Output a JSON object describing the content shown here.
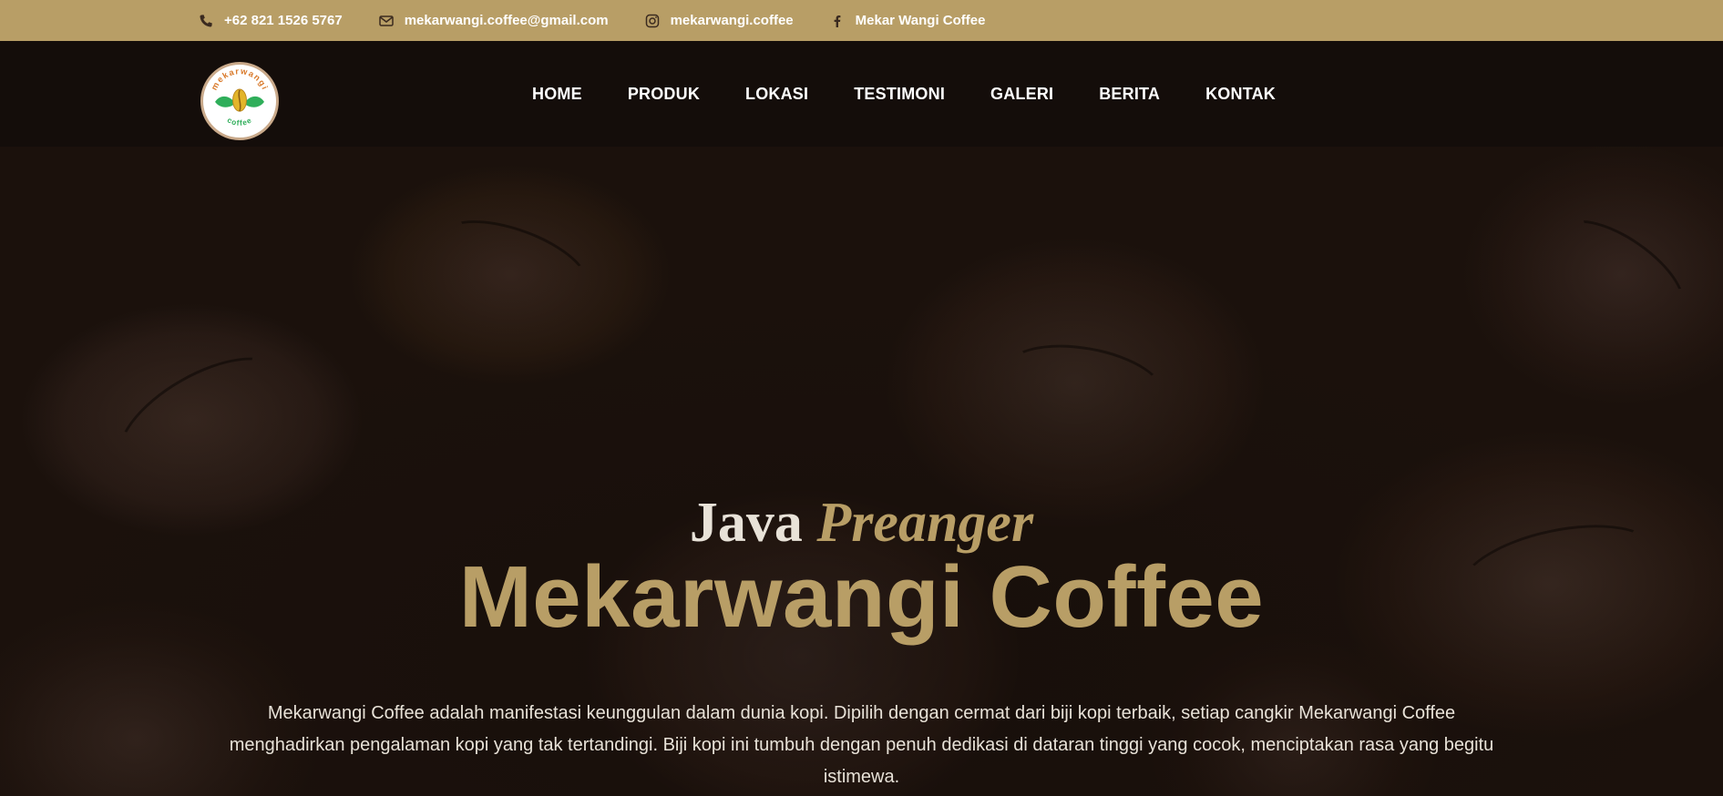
{
  "topbar": {
    "phone": "+62 821 1526 5767",
    "email": "mekarwangi.coffee@gmail.com",
    "instagram": "mekarwangi.coffee",
    "facebook": "Mekar Wangi Coffee"
  },
  "logo": {
    "top_text": "mekarwangi",
    "bottom_text": "coffee"
  },
  "nav": {
    "items": [
      "HOME",
      "PRODUK",
      "LOKASI",
      "TESTIMONI",
      "GALERI",
      "BERITA",
      "KONTAK"
    ]
  },
  "hero": {
    "subtitle_plain": "Java",
    "subtitle_accent": "Preanger",
    "title": "Mekarwangi Coffee",
    "description": "Mekarwangi Coffee adalah manifestasi keunggulan dalam dunia kopi. Dipilih dengan cermat dari biji kopi terbaik, setiap cangkir Mekarwangi Coffee menghadirkan pengalaman kopi yang tak tertandingi. Biji kopi ini tumbuh dengan penuh dedikasi di dataran tinggi yang cocok, menciptakan rasa yang begitu istimewa."
  },
  "colors": {
    "gold": "#b89e66",
    "dark": "#140d0a",
    "text_light": "#e8e2d8"
  },
  "icons": {
    "phone": "phone-icon",
    "email": "envelope-icon",
    "instagram": "instagram-icon",
    "facebook": "facebook-icon"
  }
}
